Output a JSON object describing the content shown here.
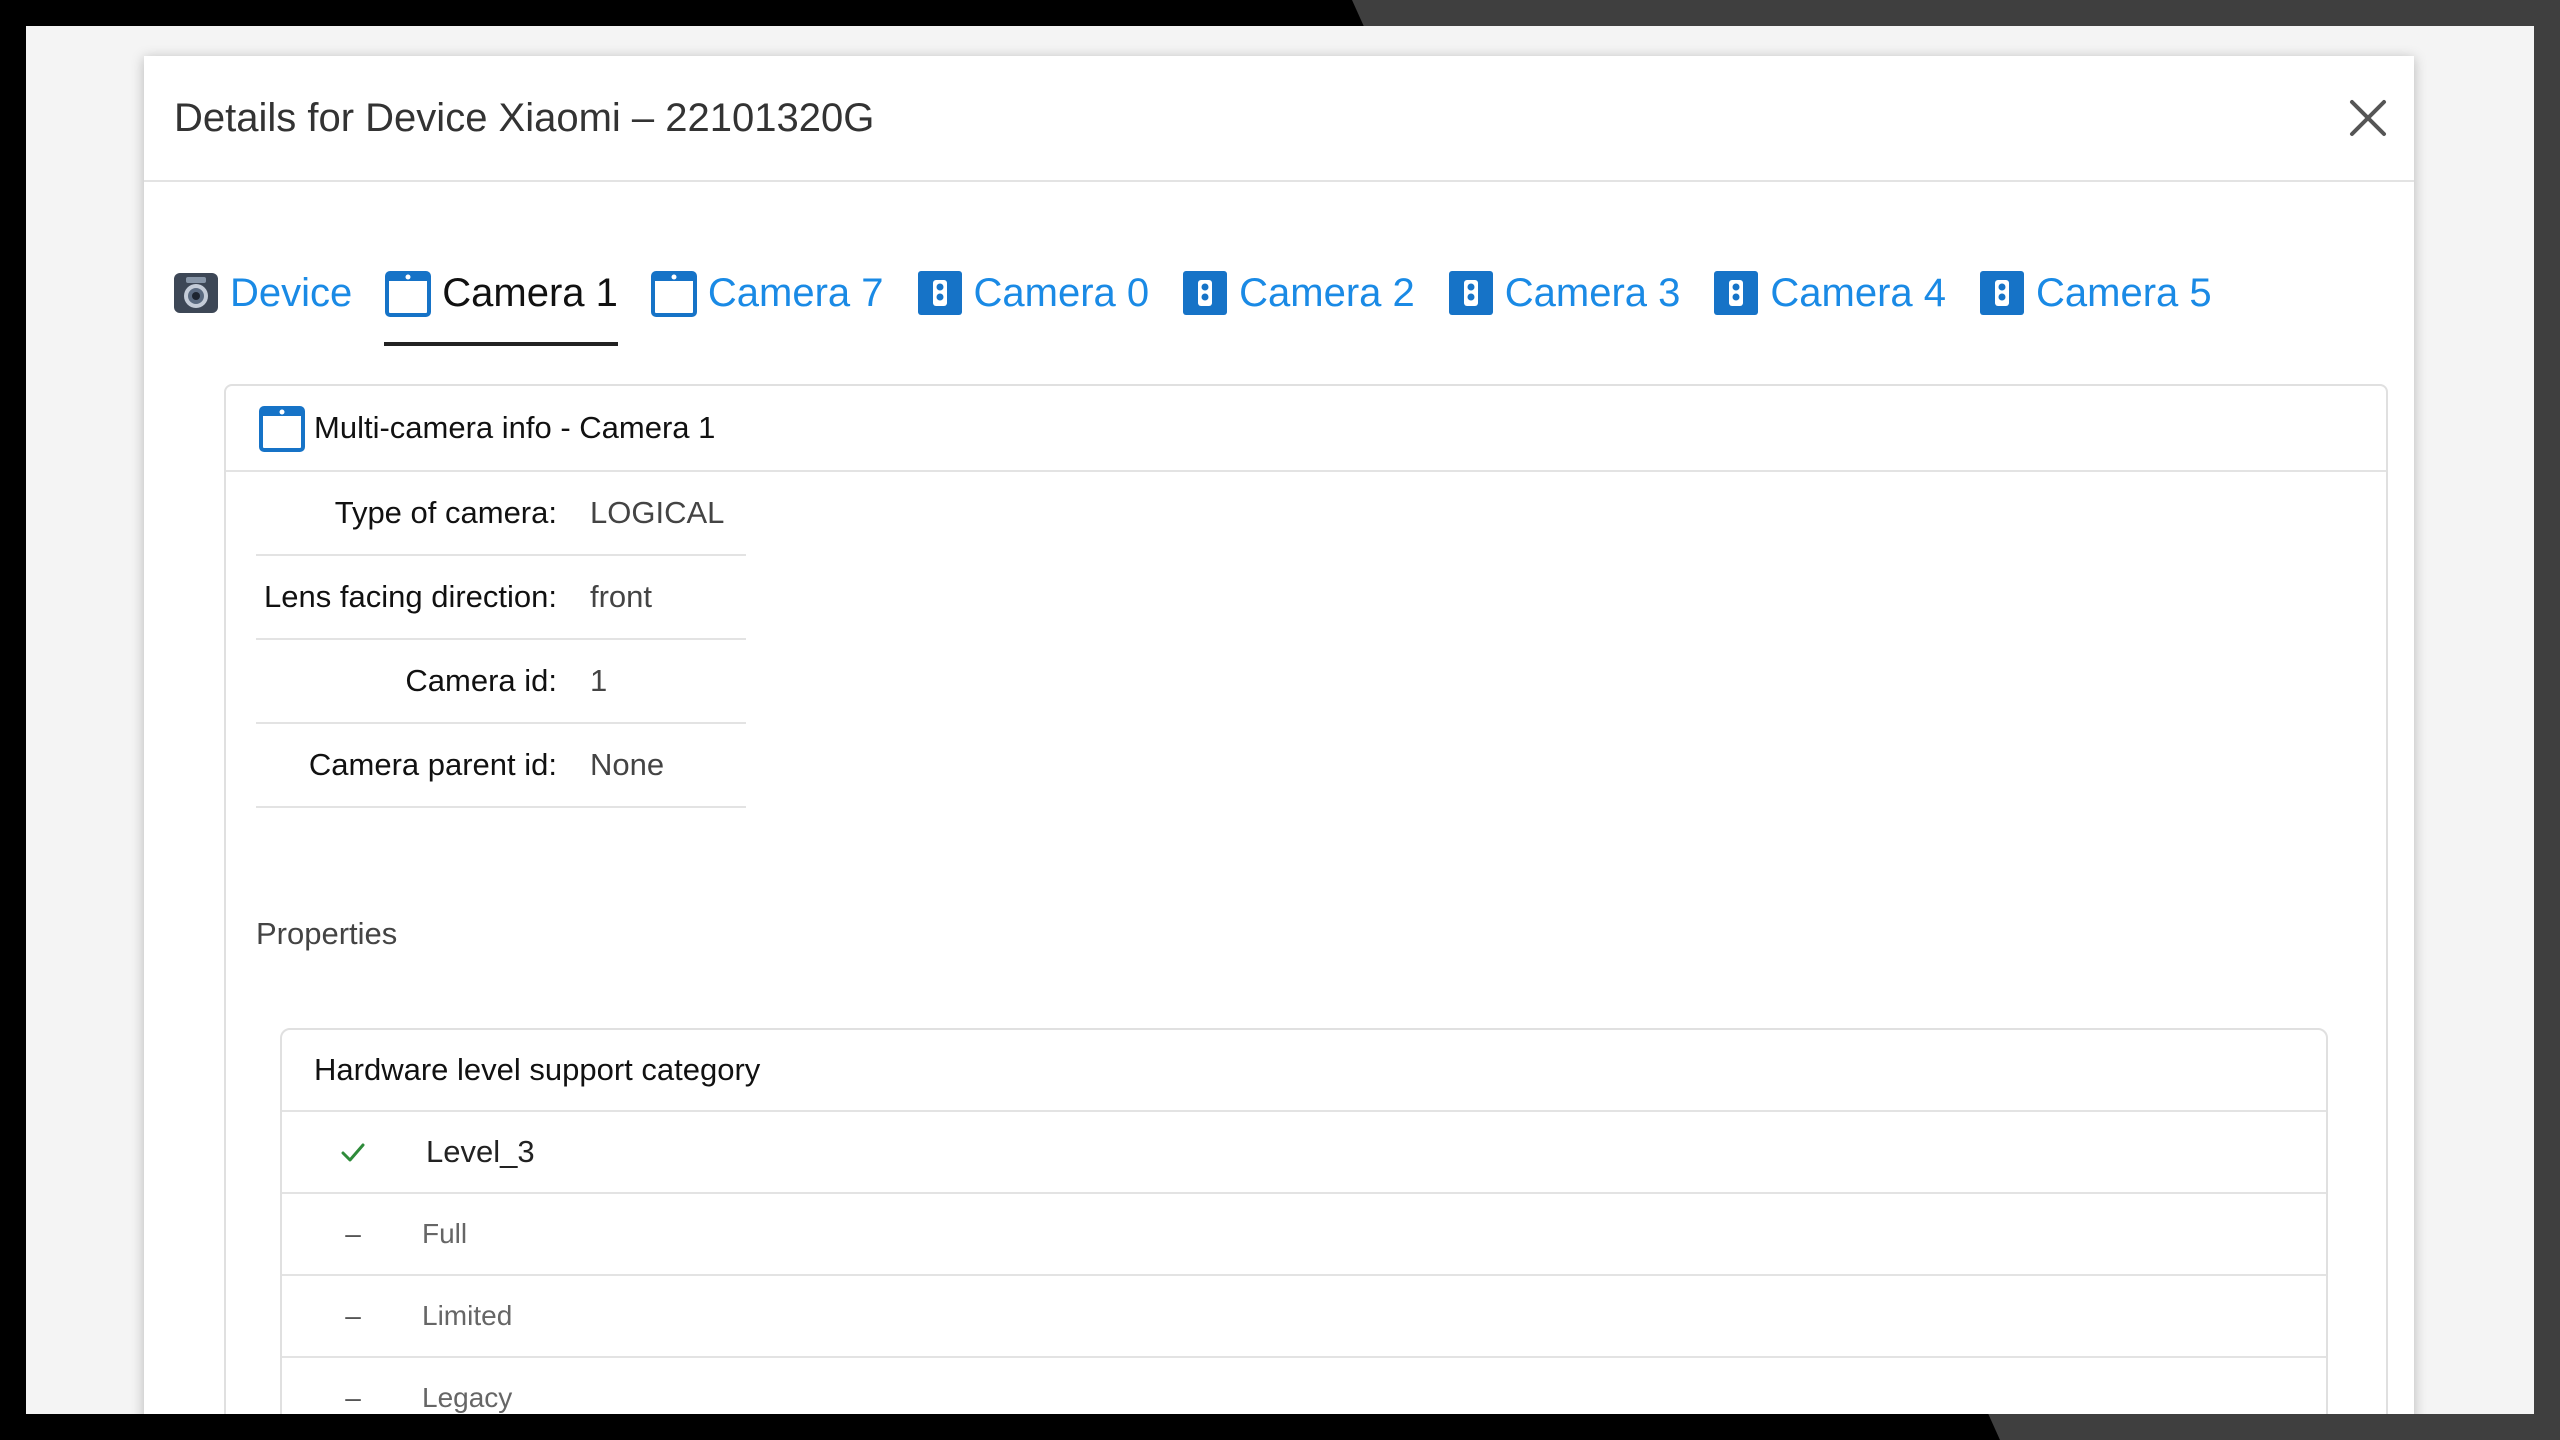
{
  "dialog": {
    "title": "Details for Device Xiaomi – 22101320G",
    "close_icon": "close-icon"
  },
  "tabs": [
    {
      "label": "Device",
      "icon": "device-camera-icon",
      "active": false
    },
    {
      "label": "Camera 1",
      "icon": "front-camera-icon",
      "active": true
    },
    {
      "label": "Camera 7",
      "icon": "front-camera-icon",
      "active": false
    },
    {
      "label": "Camera 0",
      "icon": "rear-camera-icon",
      "active": false
    },
    {
      "label": "Camera 2",
      "icon": "rear-camera-icon",
      "active": false
    },
    {
      "label": "Camera 3",
      "icon": "rear-camera-icon",
      "active": false
    },
    {
      "label": "Camera 4",
      "icon": "rear-camera-icon",
      "active": false
    },
    {
      "label": "Camera 5",
      "icon": "rear-camera-icon",
      "active": false
    }
  ],
  "card": {
    "title": "Multi-camera info - Camera 1",
    "info": [
      {
        "key": "Type of camera:",
        "value": "LOGICAL"
      },
      {
        "key": "Lens facing direction:",
        "value": "front"
      },
      {
        "key": "Camera id:",
        "value": "1"
      },
      {
        "key": "Camera parent id:",
        "value": "None"
      }
    ],
    "section_label": "Properties",
    "properties": {
      "header": "Hardware level support category",
      "rows": [
        {
          "mark": "✓",
          "label": "Level_3",
          "supported": true
        },
        {
          "mark": "–",
          "label": "Full",
          "supported": false
        },
        {
          "mark": "–",
          "label": "Limited",
          "supported": false
        },
        {
          "mark": "–",
          "label": "Legacy",
          "supported": false
        }
      ]
    }
  },
  "colors": {
    "accent": "#1a8ae5",
    "check": "#2e8b3a",
    "icon_blue": "#1673c7"
  }
}
